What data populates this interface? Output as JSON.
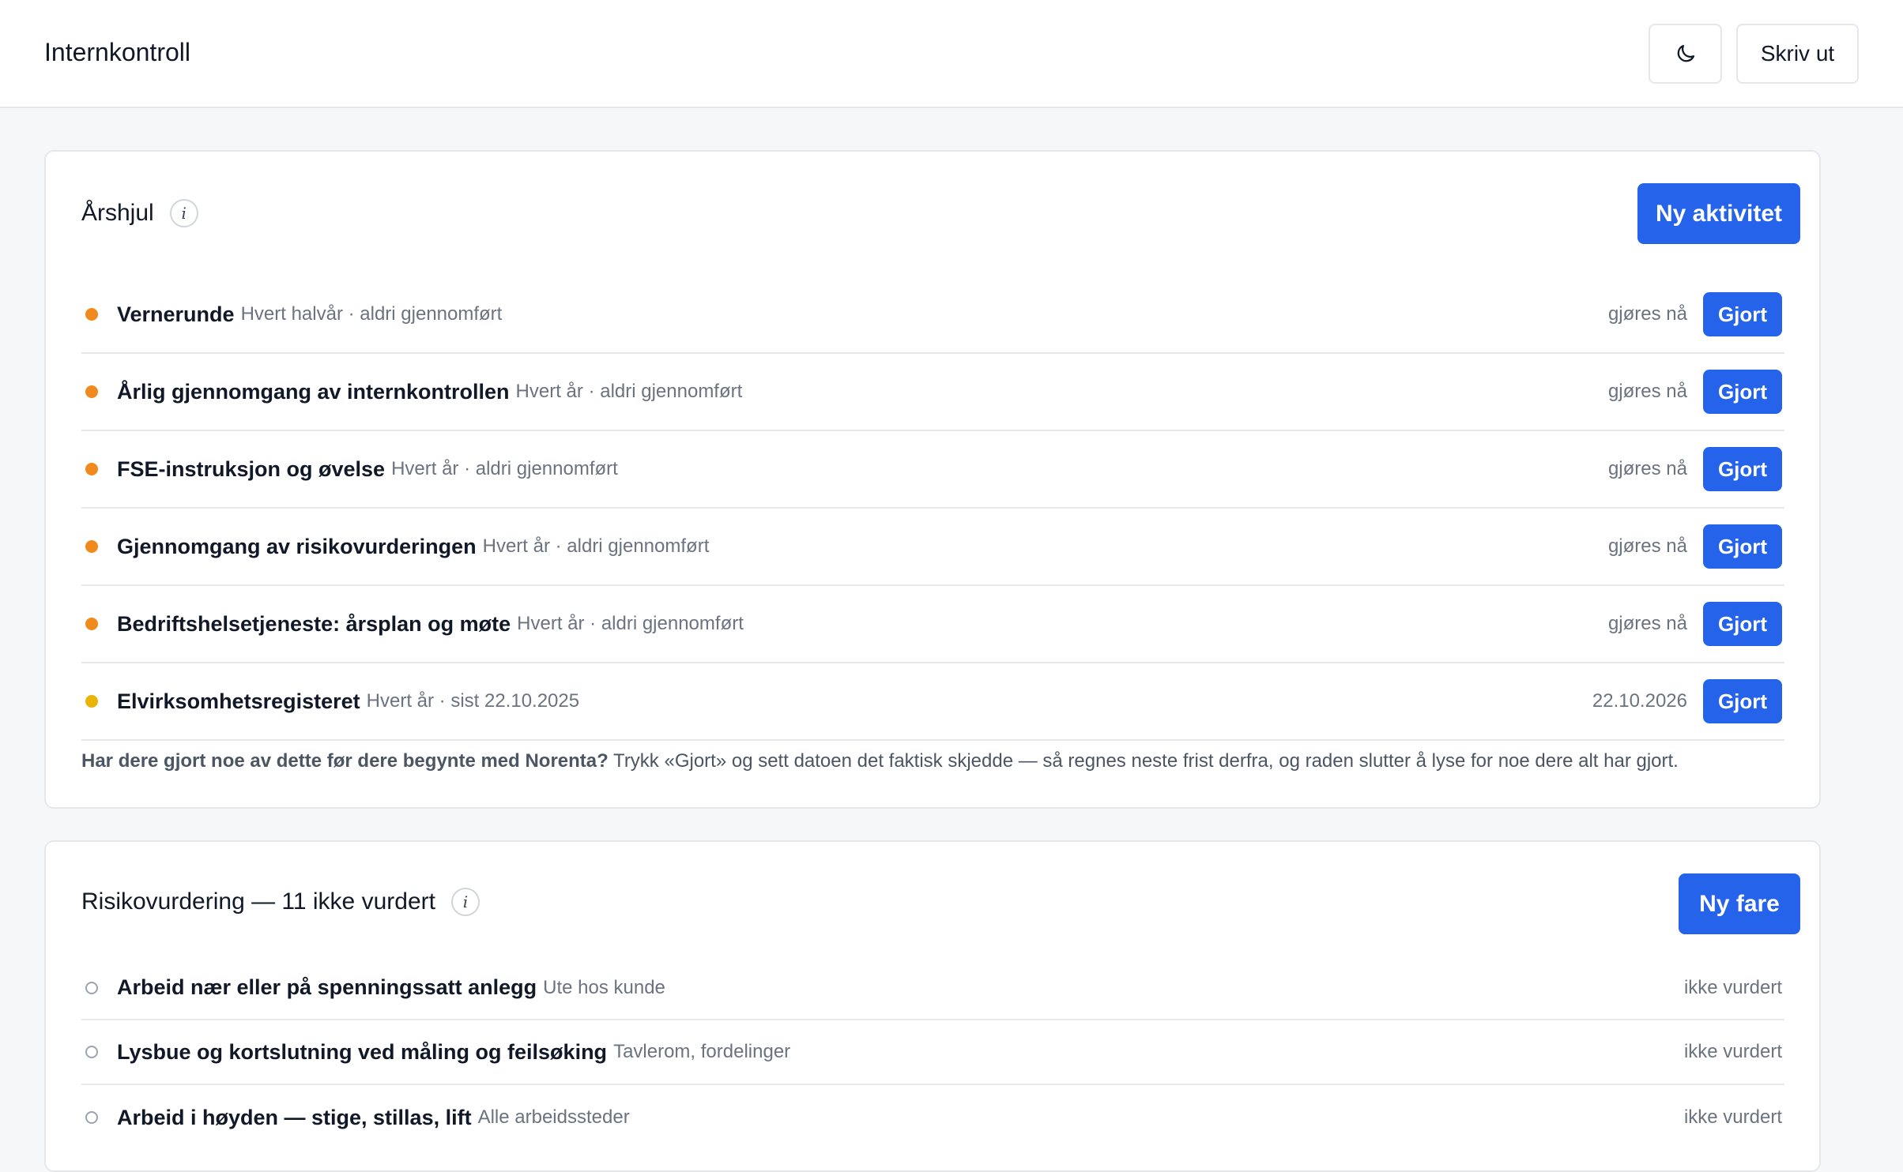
{
  "header": {
    "title": "Internkontroll",
    "print_label": "Skriv ut"
  },
  "arshjul": {
    "title": "Årshjul",
    "new_button": "Ny aktivitet",
    "done_label": "Gjort",
    "items": [
      {
        "name": "Vernerunde",
        "meta": "Hvert halvår · aldri gjennomført",
        "status": "gjøres nå"
      },
      {
        "name": "Årlig gjennomgang av internkontrollen",
        "meta": "Hvert år · aldri gjennomført",
        "status": "gjøres nå"
      },
      {
        "name": "FSE-instruksjon og øvelse",
        "meta": "Hvert år · aldri gjennomført",
        "status": "gjøres nå"
      },
      {
        "name": "Gjennomgang av risikovurderingen",
        "meta": "Hvert år · aldri gjennomført",
        "status": "gjøres nå"
      },
      {
        "name": "Bedriftshelsetjeneste: årsplan og møte",
        "meta": "Hvert år · aldri gjennomført",
        "status": "gjøres nå"
      },
      {
        "name": "Elvirksomhetsregisteret",
        "meta": "Hvert år · sist 22.10.2025",
        "status": "22.10.2026"
      }
    ],
    "hint_bold": "Har dere gjort noe av dette før dere begynte med Norenta?",
    "hint_text": "Trykk «Gjort» og sett datoen det faktisk skjedde — så regnes neste frist derfra, og raden slutter å lyse for noe dere alt har gjort."
  },
  "risiko": {
    "title": "Risikovurdering — 11 ikke vurdert",
    "new_button": "Ny fare",
    "items": [
      {
        "name": "Arbeid nær eller på spenningssatt anlegg",
        "meta": "Ute hos kunde",
        "status": "ikke vurdert"
      },
      {
        "name": "Lysbue og kortslutning ved måling og feilsøking",
        "meta": "Tavlerom, fordelinger",
        "status": "ikke vurdert"
      },
      {
        "name": "Arbeid i høyden — stige, stillas, lift",
        "meta": "Alle arbeidssteder",
        "status": "ikke vurdert"
      }
    ]
  },
  "colors": {
    "accent": "#2563eb",
    "due_now": "#f08a1c",
    "scheduled": "#eab308"
  },
  "icons": {
    "theme": "moon-icon",
    "info": "info-icon"
  }
}
